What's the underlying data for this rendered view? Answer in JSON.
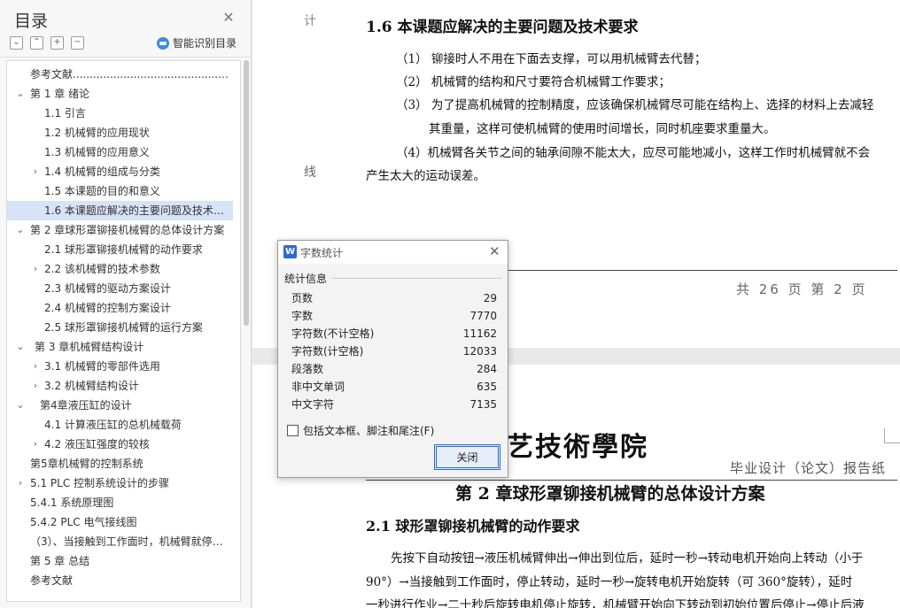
{
  "sidebar": {
    "title": "目录",
    "tools": [
      "⌄",
      "⌃",
      "+",
      "−"
    ],
    "smart_label": "智能识别目录",
    "items": [
      {
        "label": "参考文献....................................................",
        "level": 1,
        "arrow": ""
      },
      {
        "label": "第 1 章  绪论",
        "level": 0,
        "arrow": "⌄"
      },
      {
        "label": "1.1 引言",
        "level": 2,
        "arrow": ""
      },
      {
        "label": "1.2  机械臂的应用现状",
        "level": 2,
        "arrow": ""
      },
      {
        "label": "1.3  机械臂的应用意义",
        "level": 2,
        "arrow": ""
      },
      {
        "label": "1.4 机械臂的组成与分类",
        "level": 1,
        "arrow": "›"
      },
      {
        "label": "1.5 本课题的目的和意义",
        "level": 2,
        "arrow": ""
      },
      {
        "label": "1.6  本课题应解决的主要问题及技术要求",
        "level": 2,
        "arrow": "",
        "selected": true
      },
      {
        "label": "第 2 章球形罩铆接机械臂的总体设计方案",
        "level": 0,
        "arrow": "⌄"
      },
      {
        "label": "2.1  球形罩铆接机械臂的动作要求",
        "level": 2,
        "arrow": ""
      },
      {
        "label": "2.2 该机械臂的技术参数",
        "level": 1,
        "arrow": "›"
      },
      {
        "label": "2.3 机械臂的驱动方案设计",
        "level": 2,
        "arrow": ""
      },
      {
        "label": "2.4 机械臂的控制方案设计",
        "level": 2,
        "arrow": ""
      },
      {
        "label": "2.5 球形罩铆接机械臂的运行方案",
        "level": 2,
        "arrow": ""
      },
      {
        "label": "第 3 章机械臂结构设计",
        "level": 0,
        "arrow": "⌄",
        "indent_extra": true
      },
      {
        "label": "3.1 机械臂的零部件选用",
        "level": 1,
        "arrow": "›"
      },
      {
        "label": "3.2 机械臂结构设计",
        "level": 1,
        "arrow": "›"
      },
      {
        "label": "第4章液压缸的设计",
        "level": 0,
        "arrow": "⌄",
        "indent_extra2": true
      },
      {
        "label": "4.1 计算液压缸的总机械载荷",
        "level": 2,
        "arrow": ""
      },
      {
        "label": "4.2 液压缸强度的较核",
        "level": 1,
        "arrow": "›"
      },
      {
        "label": "第5章机械臂的控制系统",
        "level": 1,
        "arrow": ""
      },
      {
        "label": "5.1 PLC 控制系统设计的步骤",
        "level": 0,
        "arrow": "›",
        "root_text": true
      },
      {
        "label": "5.4.1   系统原理图",
        "level": 1,
        "arrow": ""
      },
      {
        "label": "5.4.2 PLC 电气接线图",
        "level": 1,
        "arrow": ""
      },
      {
        "label": "（3）、当接触到工作面时，机械臂就停止转动",
        "level": 1,
        "arrow": ""
      },
      {
        "label": "第 5 章  总结",
        "level": 1,
        "arrow": ""
      },
      {
        "label": "参考文献",
        "level": 1,
        "arrow": ""
      }
    ]
  },
  "page1": {
    "gutter_top": "计",
    "gutter_line": "线",
    "heading": "1.6  本课题应解决的主要问题及技术要求",
    "lines": [
      "（1）  铆接时人不用在下面去支撑，可以用机械臂去代替；",
      "（2）  机械臂的结构和尺寸要符合机械臂工作要求；",
      "（3）  为了提高机械臂的控制精度，应该确保机械臂尽可能在结构上、选择的材料上去减轻",
      "其重量，这样可使机械臂的使用时间增长，同时机座要求重量大。",
      "（4）机械臂各关节之间的轴承间隙不能太大，应尽可能地减小，这样工作时机械臂就不会",
      "产生太大的运动误差。"
    ],
    "footer": "共  26 页    第  2  页"
  },
  "page2": {
    "logo": "艺技術學院",
    "report_title": "毕业设计（论文）报告纸",
    "chapter": "第 2 章球形罩铆接机械臂的总体设计方案",
    "section": "2.1  球形罩铆接机械臂的动作要求",
    "lines": [
      "先按下自动按钮→液压机械臂伸出→伸出到位后，延时一秒→转动电机开始向上转动（小于",
      "90°）→当接触到工作面时，停止转动，延时一秒→旋转电机开始旋转（可 360°旋转），延时",
      "一秒进行作业→二十秒后旋转电机停止旋转，机械臂开始向下转动到初始位置后停止→停止后液"
    ]
  },
  "dialog": {
    "icon": "W",
    "title": "字数统计",
    "section": "统计信息",
    "stats": [
      {
        "label": "页数",
        "value": "29"
      },
      {
        "label": "字数",
        "value": "7770"
      },
      {
        "label": "字符数(不计空格)",
        "value": "11162"
      },
      {
        "label": "字符数(计空格)",
        "value": "12033"
      },
      {
        "label": "段落数",
        "value": "284"
      },
      {
        "label": "非中文单词",
        "value": "635"
      },
      {
        "label": "中文字符",
        "value": "7135"
      }
    ],
    "checkbox_label": "包括文本框、脚注和尾注(F)",
    "close_label": "关闭"
  }
}
